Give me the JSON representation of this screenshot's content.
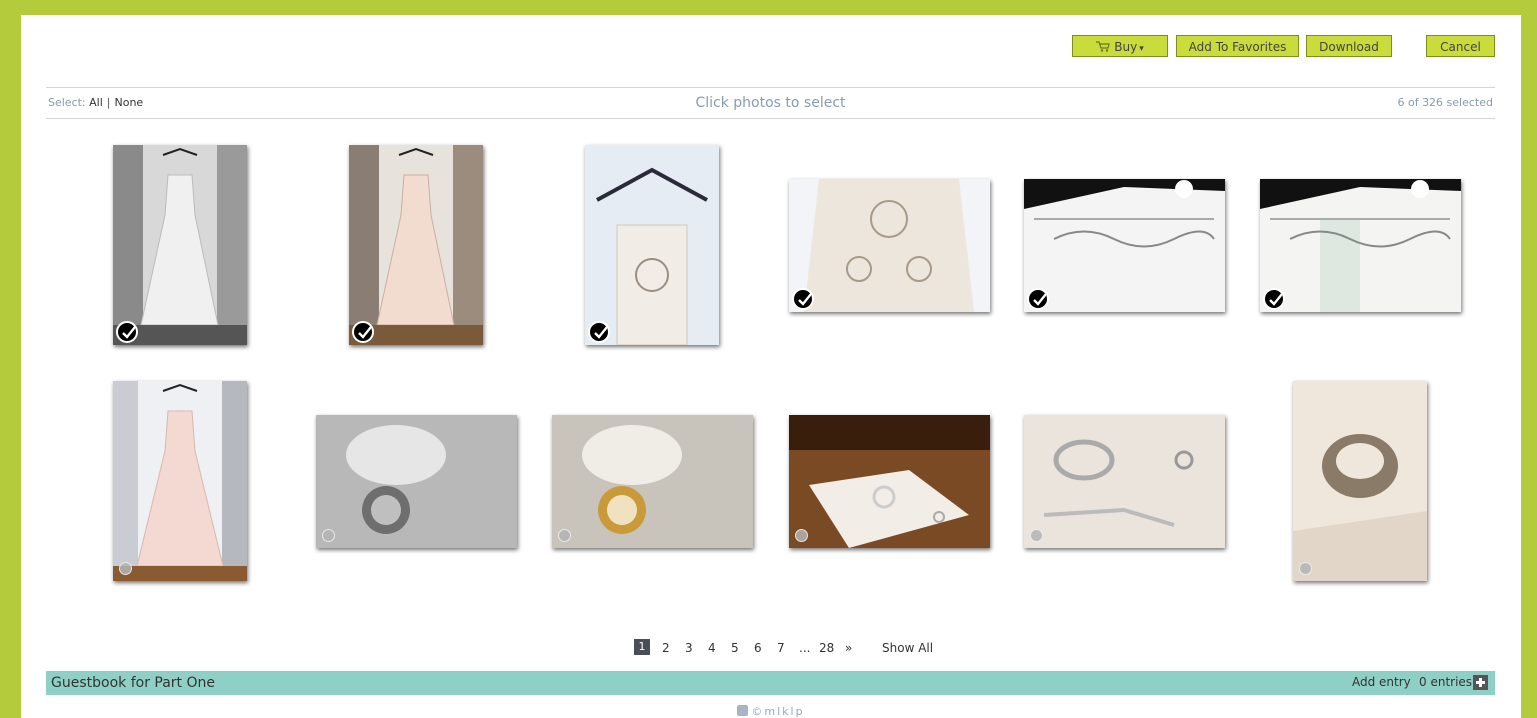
{
  "toolbar": {
    "buy_label": "Buy",
    "buy_caret": "▾",
    "favorites_label": "Add To Favorites",
    "download_label": "Download",
    "cancel_label": "Cancel"
  },
  "selection": {
    "prefix": "Select:",
    "all_label": "All",
    "separator": "|",
    "none_label": "None",
    "instruction": "Click photos to select",
    "count_text": "6 of 326 selected",
    "selected_count": 6,
    "total_count": 326
  },
  "photos": [
    {
      "name": "wedding-dress-bw",
      "selected": true
    },
    {
      "name": "wedding-dress-color",
      "selected": true
    },
    {
      "name": "dress-hanger-closeup",
      "selected": true
    },
    {
      "name": "dress-bodice-detail",
      "selected": true
    },
    {
      "name": "mrs-jacques-hanger-bw",
      "selected": true
    },
    {
      "name": "mrs-jacques-hanger-color",
      "selected": true
    },
    {
      "name": "dress-back-pink",
      "selected": false
    },
    {
      "name": "brooch-bw",
      "selected": false
    },
    {
      "name": "brooch-gold",
      "selected": false
    },
    {
      "name": "jewelry-on-handkerchief",
      "selected": false
    },
    {
      "name": "bracelet-and-rings",
      "selected": false
    },
    {
      "name": "ring-closeup",
      "selected": false
    }
  ],
  "pagination": {
    "pages": [
      "1",
      "2",
      "3",
      "4",
      "5",
      "6",
      "7"
    ],
    "current": "1",
    "ellipsis": "...",
    "last_page": "28",
    "next_label": "»",
    "show_all_label": "Show All"
  },
  "guestbook": {
    "title": "Guestbook for Part One",
    "add_entry_label": "Add entry",
    "entries_text": "0 entries"
  },
  "footer": {
    "credit": "©mlklp"
  },
  "colors": {
    "background": "#b4cc3c",
    "button": "#c9dc3b",
    "guestbook_bar": "#8fd0c6",
    "muted_text": "#8a9bb0"
  }
}
